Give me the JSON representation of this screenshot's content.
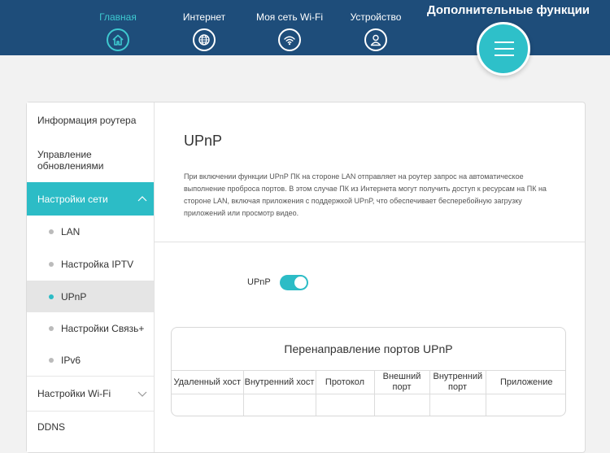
{
  "nav": {
    "items": [
      {
        "label": "Главная",
        "icon": "home-icon",
        "active": true
      },
      {
        "label": "Интернет",
        "icon": "globe-icon",
        "active": false
      },
      {
        "label": "Моя сеть Wi-Fi",
        "icon": "wifi-icon",
        "active": false
      },
      {
        "label": "Устройство",
        "icon": "user-icon",
        "active": false
      }
    ],
    "more_title": "Дополнительные функции"
  },
  "sidebar": {
    "router_info": "Информация роутера",
    "update_mgmt": "Управление обновлениями",
    "network_settings": "Настройки сети",
    "lan": "LAN",
    "iptv": "Настройка IPTV",
    "upnp": "UPnP",
    "svyaz": "Настройки Связь+",
    "ipv6": "IPv6",
    "wifi_settings": "Настройки Wi-Fi",
    "ddns": "DDNS"
  },
  "content": {
    "title": "UPnP",
    "description": "При включении функции UPnP ПК на стороне LAN отправляет на роутер запрос на автоматическое выполнение проброса портов. В этом случае ПК из Интернета могут получить доступ к ресурсам на ПК на стороне LAN, включая приложения с поддержкой UPnP, что обеспечивает бесперебойную загрузку приложений или просмотр видео.",
    "toggle_label": "UPnP",
    "toggle_on": true
  },
  "port_table": {
    "title": "Перенаправление портов UPnP",
    "headers": [
      "Удаленный хост",
      "Внутренний хост",
      "Протокол",
      "Внешний порт",
      "Внутренний порт",
      "Приложение"
    ]
  },
  "colors": {
    "header_bg": "#1e4d7a",
    "accent": "#2cbcc6"
  }
}
